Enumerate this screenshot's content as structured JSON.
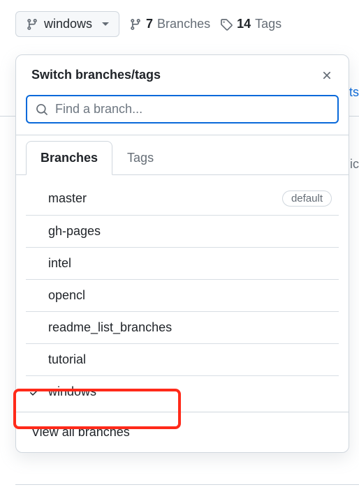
{
  "top": {
    "current_branch": "windows",
    "branches_count": "7",
    "branches_label": "Branches",
    "tags_count": "14",
    "tags_label": "Tags"
  },
  "dropdown": {
    "title": "Switch branches/tags",
    "search_placeholder": "Find a branch...",
    "tabs": {
      "branches": "Branches",
      "tags": "Tags"
    },
    "default_label": "default",
    "branches": [
      {
        "name": "master",
        "default": true,
        "selected": false
      },
      {
        "name": "gh-pages",
        "default": false,
        "selected": false
      },
      {
        "name": "intel",
        "default": false,
        "selected": false
      },
      {
        "name": "opencl",
        "default": false,
        "selected": false
      },
      {
        "name": "readme_list_branches",
        "default": false,
        "selected": false
      },
      {
        "name": "tutorial",
        "default": false,
        "selected": false
      },
      {
        "name": "windows",
        "default": false,
        "selected": true
      }
    ],
    "view_all": "View all branches"
  },
  "bg": {
    "commits_fragment": "ts",
    "ic_fragment": "ic"
  }
}
